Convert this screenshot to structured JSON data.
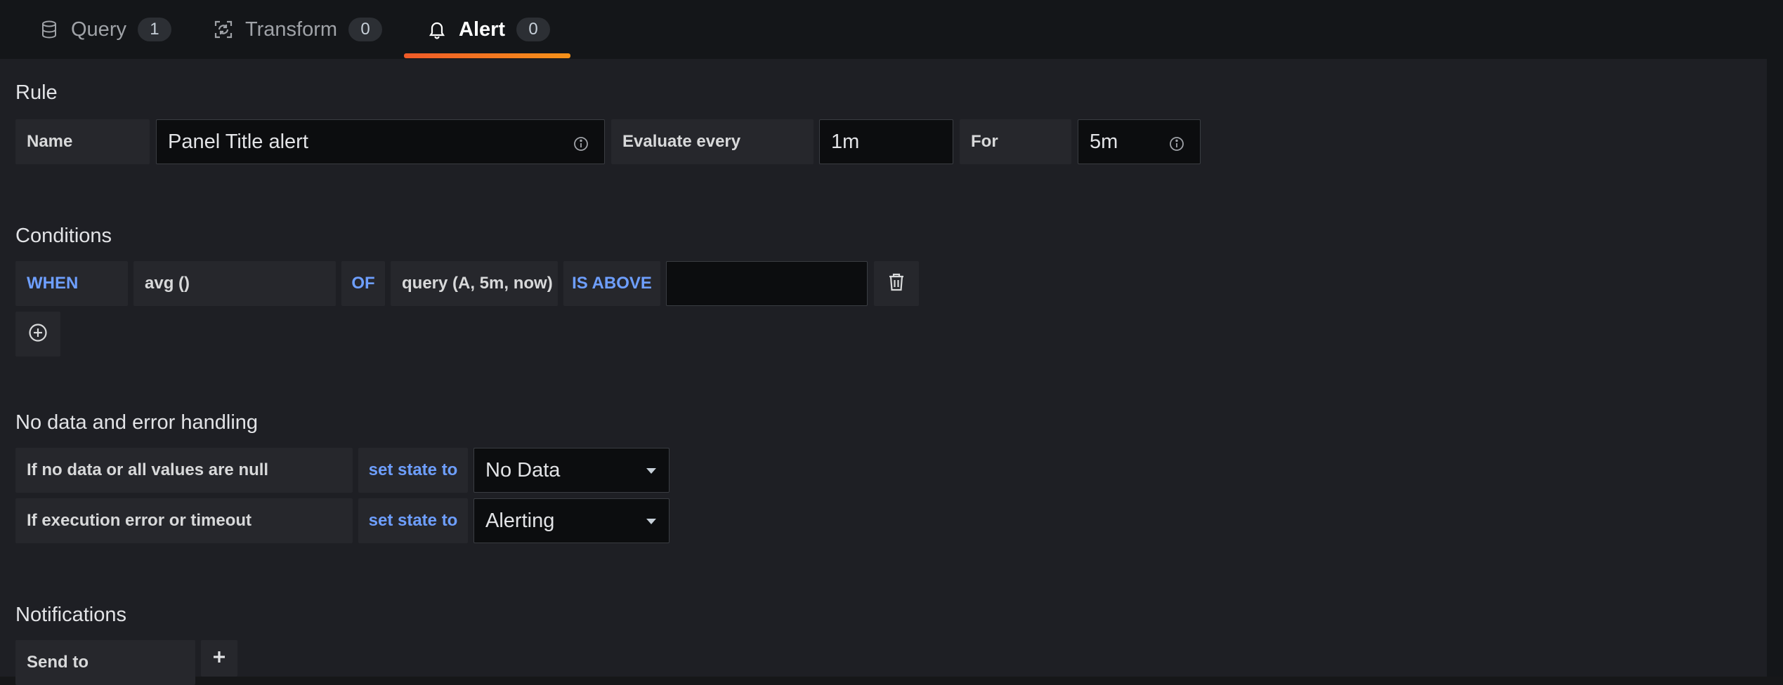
{
  "tabs": [
    {
      "label": "Query",
      "count": "1",
      "icon": "database-icon"
    },
    {
      "label": "Transform",
      "count": "0",
      "icon": "transform-icon"
    },
    {
      "label": "Alert",
      "count": "0",
      "icon": "bell-icon",
      "active": true
    }
  ],
  "rule": {
    "title": "Rule",
    "name_label": "Name",
    "name_value": "Panel Title alert",
    "evaluate_label": "Evaluate every",
    "evaluate_value": "1m",
    "for_label": "For",
    "for_value": "5m"
  },
  "conditions": {
    "title": "Conditions",
    "when": "WHEN",
    "reducer": "avg ()",
    "of": "OF",
    "query": "query (A, 5m, now)",
    "evaluator": "IS ABOVE",
    "threshold_value": ""
  },
  "nodata": {
    "title": "No data and error handling",
    "rows": [
      {
        "label": "If no data or all values are null",
        "set_state": "set state to",
        "value": "No Data"
      },
      {
        "label": "If execution error or timeout",
        "set_state": "set state to",
        "value": "Alerting"
      }
    ]
  },
  "notifications": {
    "title": "Notifications",
    "send_to_label": "Send to"
  },
  "colors": {
    "accent_keyword": "#6e9fff",
    "tab_underline": "#f05a28",
    "background": "#1e1f24"
  }
}
